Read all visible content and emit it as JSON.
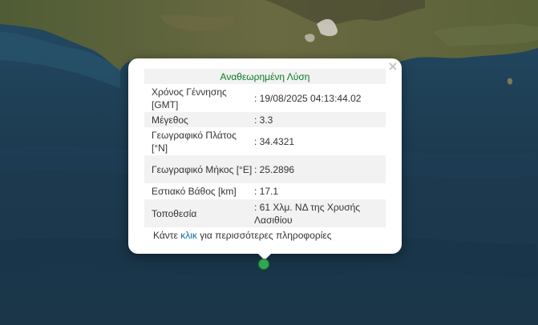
{
  "popup": {
    "title": "Αναθεωρημένη Λύση",
    "close_symbol": "×",
    "rows": [
      {
        "label": "Χρόνος Γέννησης [GMT]",
        "value": ": 19/08/2025 04:13:44.02"
      },
      {
        "label": "Μέγεθος",
        "value": ": 3.3"
      },
      {
        "label": "Γεωγραφικό Πλάτος [°N]",
        "value": ": 34.4321"
      },
      {
        "label": "Γεωγραφικό Μήκος [°E]",
        "value": ": 25.2896"
      },
      {
        "label": "Εστιακό Βάθος [km]",
        "value": ": 17.1"
      },
      {
        "label": "Τοποθεσία",
        "value": ": 61 Χλμ. ΝΔ της Χρυσής Λασιθίου"
      }
    ],
    "footer": {
      "before": "Κάντε ",
      "link": "κλικ",
      "after": " για περισσότερες πληροφορίες"
    }
  },
  "marker": {
    "color": "#2fa84f",
    "icon": "earthquake-marker"
  },
  "colors": {
    "sea": "#1d3b50",
    "land": "#5f6a3e",
    "title": "#0a7a1f",
    "link": "#0b6fa8"
  }
}
